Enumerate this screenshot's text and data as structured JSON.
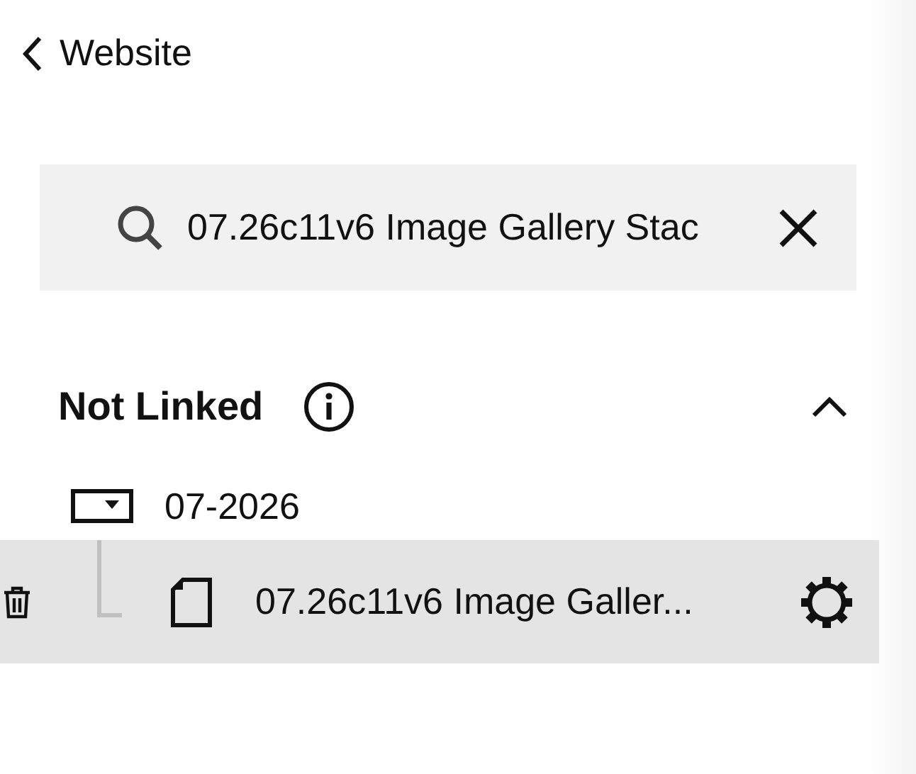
{
  "back": {
    "label": "Website"
  },
  "search": {
    "value": "07.26c11v6 Image Gallery Stac"
  },
  "section": {
    "title": "Not Linked",
    "expanded": true,
    "items": [
      {
        "label": "07-2026",
        "kind": "folder",
        "expanded": true,
        "children": [
          {
            "label": "07.26c11v6 Image Galler...",
            "kind": "page",
            "selected": true
          }
        ]
      }
    ]
  }
}
